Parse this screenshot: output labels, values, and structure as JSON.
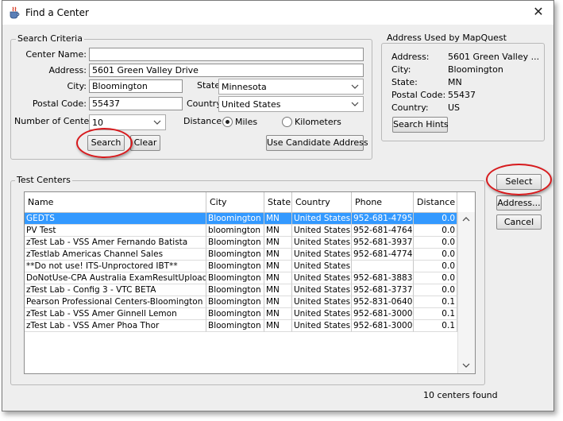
{
  "window": {
    "title": "Find a Center",
    "close": "✕"
  },
  "search_criteria": {
    "legend": "Search Criteria",
    "center_name_label": "Center Name:",
    "center_name_value": "",
    "address_label": "Address:",
    "address_value": "5601 Green Valley Drive",
    "city_label": "City:",
    "city_value": "Bloomington",
    "state_label": "State:",
    "state_value": "Minnesota",
    "postal_label": "Postal Code:",
    "postal_value": "55437",
    "country_label": "Country:",
    "country_value": "United States",
    "num_centers_label": "Number of Centers:",
    "num_centers_value": "10",
    "distance_label": "Distance:",
    "miles_label": "Miles",
    "km_label": "Kilometers",
    "distance_selected": "Miles",
    "search_button": "Search",
    "clear_button": "Clear",
    "use_candidate_button": "Use Candidate Address"
  },
  "mapquest": {
    "legend": "Address Used by MapQuest",
    "address_label": "Address:",
    "address_value": "5601 Green Valley ...",
    "city_label": "City:",
    "city_value": "Bloomington",
    "state_label": "State:",
    "state_value": "MN",
    "postal_label": "Postal Code:",
    "postal_value": "55437",
    "country_label": "Country:",
    "country_value": "US",
    "hints_button": "Search Hints"
  },
  "test_centers": {
    "legend": "Test Centers",
    "columns": [
      "Name",
      "City",
      "State",
      "Country",
      "Phone",
      "Distance"
    ],
    "rows": [
      [
        "GEDTS",
        "Bloomington",
        "MN",
        "United States",
        "952-681-4795",
        "0.0"
      ],
      [
        "PV Test",
        "bloomington",
        "MN",
        "United States",
        "952-681-4764",
        "0.0"
      ],
      [
        "zTest Lab - VSS Amer Fernando Batista",
        "Bloomington",
        "MN",
        "United States",
        "952-681-3937",
        "0.0"
      ],
      [
        "zTestlab Americas Channel Sales",
        "Bloomington",
        "MN",
        "United States",
        "952-681-4774",
        "0.0"
      ],
      [
        "**Do not use! ITS-Unproctored IBT**",
        "Bloomington",
        "MN",
        "United States",
        "",
        "0.0"
      ],
      [
        "DoNotUse-CPA Australia ExamResultUpload",
        "Bloomington",
        "MN",
        "United States",
        "952-681-3883",
        "0.0"
      ],
      [
        "zTest Lab - Config 3 - VTC BETA",
        "Bloomington",
        "MN",
        "United States",
        "952-681-3737",
        "0.0"
      ],
      [
        "Pearson Professional Centers-Bloomington (...",
        "Bloomington",
        "MN",
        "United States",
        "952-831-0640",
        "0.1"
      ],
      [
        "zTest Lab - VSS Amer Ginnell Lemon",
        "Bloomington",
        "MN",
        "United States",
        "952-681-3000",
        "0.1"
      ],
      [
        "zTest Lab - VSS Amer Phoa Thor",
        "Bloomington",
        "MN",
        "United States",
        "952-681-3000",
        "0.1"
      ]
    ],
    "selected_row": 0
  },
  "side_buttons": {
    "select": "Select",
    "address": "Address...",
    "cancel": "Cancel"
  },
  "status": {
    "count_text": "10 centers found"
  },
  "colors": {
    "selection": "#3399ff",
    "highlight_circle": "#d7191c",
    "window_bg": "#eeeeee"
  },
  "icons": {
    "app": "java-cup-icon",
    "close": "close-icon",
    "combo": "chevron-down-icon"
  }
}
